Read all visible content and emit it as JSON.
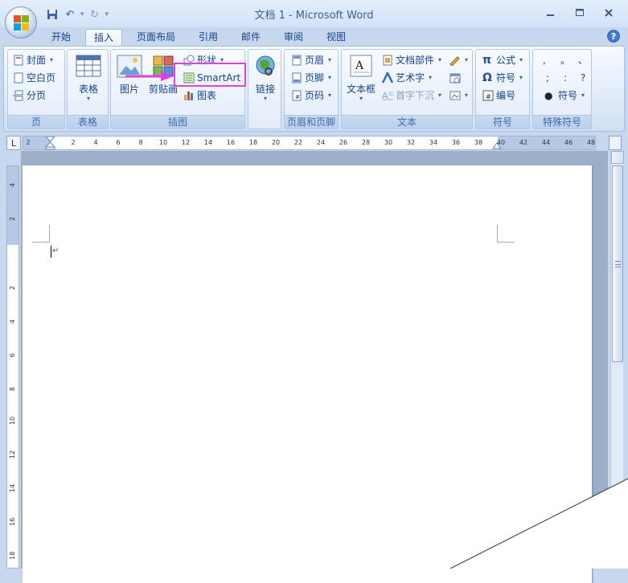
{
  "window": {
    "title": "文档 1 - Microsoft Word",
    "minimize_icon": "minimize-icon",
    "maximize_icon": "maximize-icon",
    "close_icon": "close-icon"
  },
  "quick_access": {
    "save": "💾",
    "undo": "↶",
    "redo": "↻",
    "more": "▾"
  },
  "tabs": [
    {
      "label": "开始"
    },
    {
      "label": "插入"
    },
    {
      "label": "页面布局"
    },
    {
      "label": "引用"
    },
    {
      "label": "邮件"
    },
    {
      "label": "审阅"
    },
    {
      "label": "视图"
    }
  ],
  "active_tab": "插入",
  "ribbon": {
    "pages": {
      "label": "页",
      "cover": "封面",
      "blank": "空白页",
      "break": "分页"
    },
    "table": {
      "label": "表格",
      "button": "表格"
    },
    "illustrations": {
      "label": "插图",
      "picture": "图片",
      "clipart": "剪贴画",
      "shapes": "形状",
      "smartart": "SmartArt",
      "chart": "图表"
    },
    "links": {
      "button": "链接"
    },
    "header_footer": {
      "label": "页眉和页脚",
      "header": "页眉",
      "footer": "页脚",
      "page_number": "页码"
    },
    "text": {
      "label": "文本",
      "textbox": "文本框",
      "quickparts": "文档部件",
      "wordart": "艺术字",
      "dropcap": "首字下沉"
    },
    "symbols": {
      "label": "符号",
      "equation": "公式",
      "symbol": "符号",
      "numbering": "编号"
    },
    "special": {
      "label": "特殊符号",
      "row1": [
        ",",
        "。",
        "、"
      ],
      "row2": [
        ";",
        ":",
        "?"
      ],
      "symbol": "符号"
    }
  },
  "ruler": {
    "ticks": [
      "2",
      "2",
      "4",
      "6",
      "8",
      "10",
      "12",
      "14",
      "16",
      "18",
      "20",
      "22",
      "24",
      "26",
      "28",
      "30",
      "32",
      "34",
      "36",
      "38",
      "40",
      "42",
      "44",
      "46",
      "48"
    ],
    "vticks": [
      "4",
      "2",
      "2",
      "4",
      "6",
      "8",
      "10",
      "12",
      "14",
      "16",
      "18"
    ]
  },
  "colors": {
    "highlight": "#e23ee3",
    "ribbon_text": "#15428b"
  }
}
